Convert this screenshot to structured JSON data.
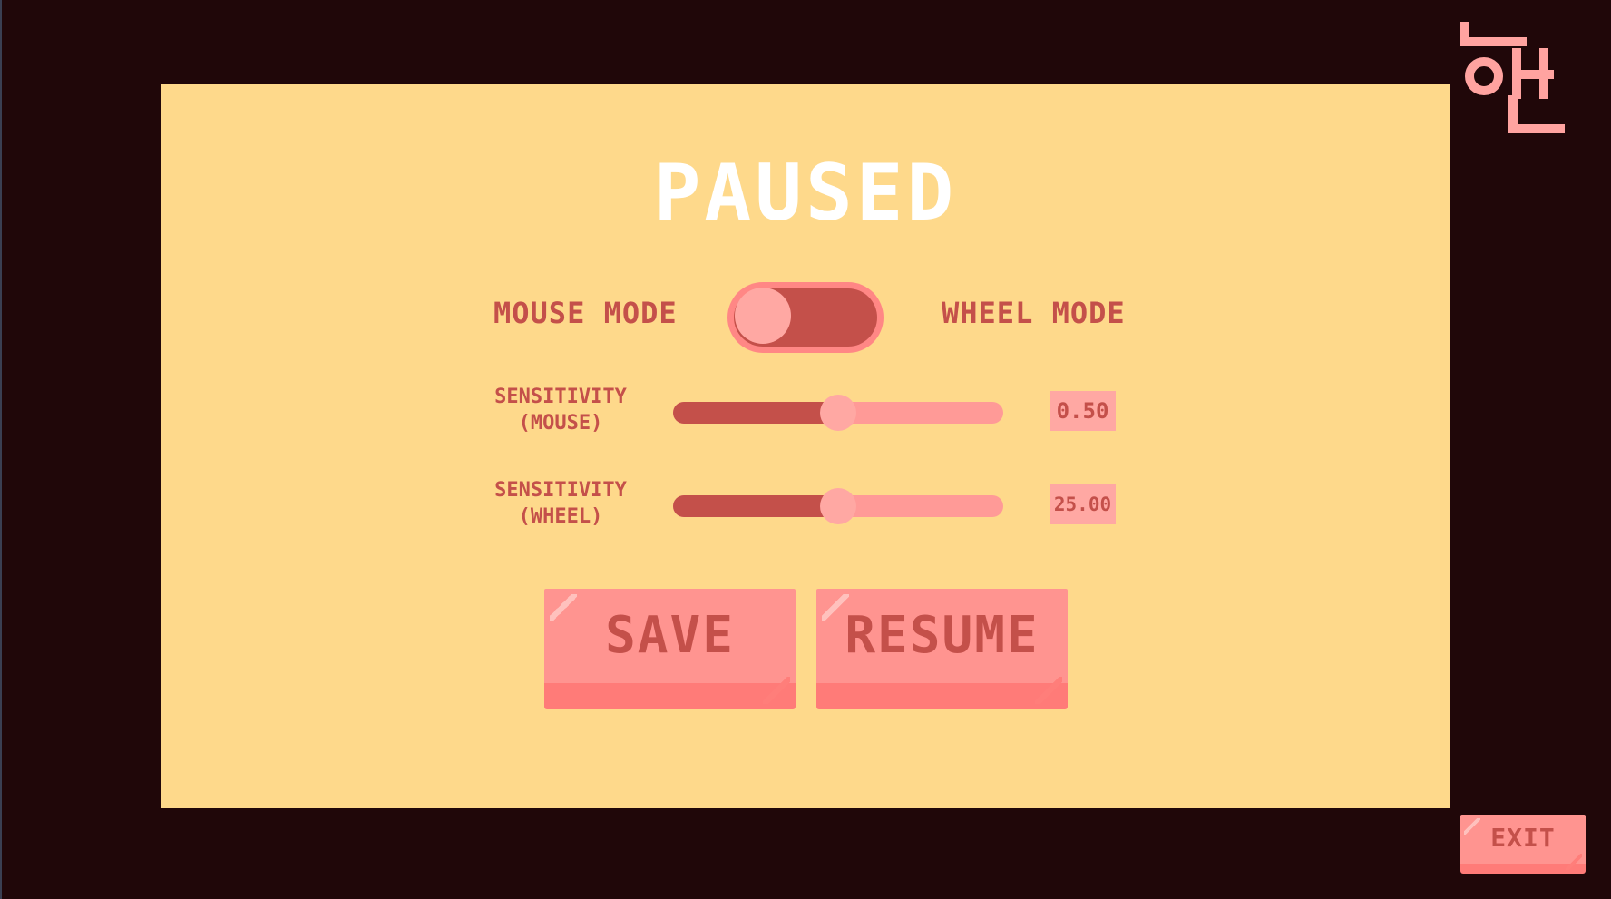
{
  "title": "PAUSED",
  "mode_toggle": {
    "left_label": "MOUSE MODE",
    "right_label": "WHEEL MODE",
    "selected": "MOUSE MODE"
  },
  "sensitivity_mouse": {
    "label_line1": "SENSITIVITY",
    "label_line2": "(MOUSE)",
    "value_text": "0.50",
    "fraction": 0.5
  },
  "sensitivity_wheel": {
    "label_line1": "SENSITIVITY",
    "label_line2": "(WHEEL)",
    "value_text": "25.00",
    "fraction": 0.5
  },
  "buttons": {
    "save": "SAVE",
    "resume": "RESUME",
    "exit": "EXIT"
  },
  "logo_icon": "hangul-logo-icon",
  "colors": {
    "background": "#200709",
    "panel": "#fed98b",
    "accent_dark": "#c4504a",
    "accent_light": "#ff9490",
    "title": "#ffffff"
  }
}
